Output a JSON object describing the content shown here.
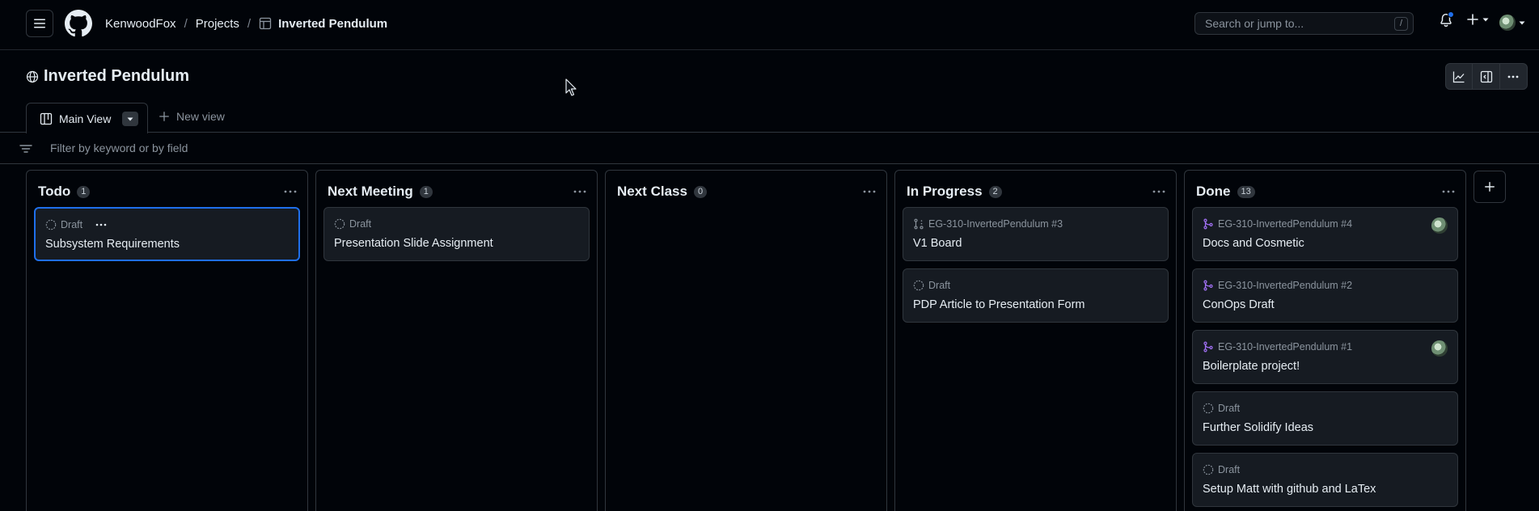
{
  "header": {
    "owner": "KenwoodFox",
    "projects": "Projects",
    "project": "Inverted Pendulum",
    "separator": "/",
    "search_placeholder": "Search or jump to...",
    "search_shortcut": "/"
  },
  "project_title": "Inverted Pendulum",
  "views": {
    "main_label": "Main View",
    "new_label": "New view"
  },
  "filter": {
    "placeholder": "Filter by keyword or by field"
  },
  "columns": [
    {
      "title": "Todo",
      "count": "1",
      "cards": [
        {
          "meta": "Draft",
          "title": "Subsystem Requirements",
          "icon": "draft-icon"
        }
      ]
    },
    {
      "title": "Next Meeting",
      "count": "1",
      "cards": [
        {
          "meta": "Draft",
          "title": "Presentation Slide Assignment",
          "icon": "draft-icon"
        }
      ]
    },
    {
      "title": "Next Class",
      "count": "0",
      "cards": []
    },
    {
      "title": "In Progress",
      "count": "2",
      "cards": [
        {
          "meta": "EG-310-InvertedPendulum #3",
          "title": "V1 Board",
          "icon": "pull-request-draft-icon"
        },
        {
          "meta": "Draft",
          "title": "PDP Article to Presentation Form",
          "icon": "draft-icon"
        }
      ]
    },
    {
      "title": "Done",
      "count": "13",
      "cards": [
        {
          "meta": "EG-310-InvertedPendulum #4",
          "title": "Docs and Cosmetic",
          "icon": "merged-icon"
        },
        {
          "meta": "EG-310-InvertedPendulum #2",
          "title": "ConOps Draft",
          "icon": "merged-icon"
        },
        {
          "meta": "EG-310-InvertedPendulum #1",
          "title": "Boilerplate project!",
          "icon": "merged-icon"
        },
        {
          "meta": "Draft",
          "title": "Further Solidify Ideas",
          "icon": "draft-icon"
        },
        {
          "meta": "Draft",
          "title": "Setup Matt with github and LaTex",
          "icon": "draft-icon"
        }
      ]
    }
  ],
  "colors": {
    "background": "#010409",
    "card": "#161b22",
    "border": "#30363d",
    "selected": "#1f6feb",
    "merged": "#a371f7",
    "notification": "#1f6feb"
  }
}
